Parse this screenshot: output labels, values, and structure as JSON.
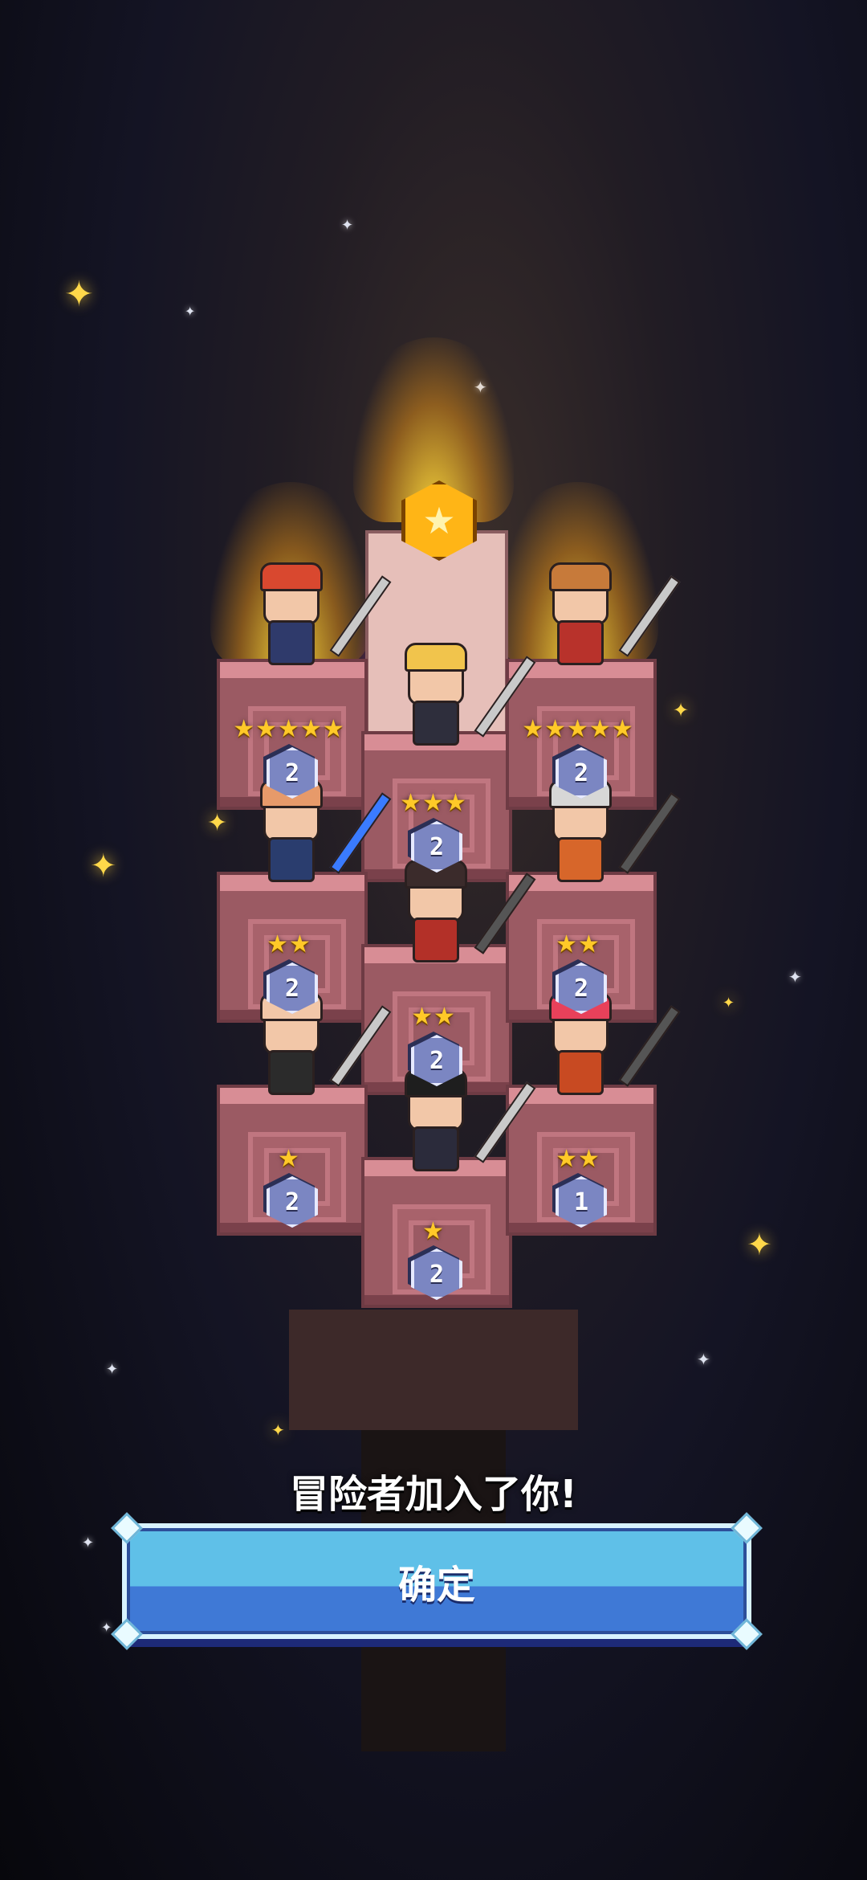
{
  "message": "冒险者加入了你!",
  "confirm_label": "确定",
  "top_medal": {
    "icon": "star-medal-icon",
    "star": "★"
  },
  "slots": [
    {
      "id": "top-left",
      "stars": "★★★★★",
      "level": "2",
      "highlight": "gold",
      "hair": "#d9482f",
      "outfit": "#2f3a6b"
    },
    {
      "id": "top-center",
      "stars": "★★★",
      "level": "2",
      "highlight": "pink",
      "hair": "#f1c44c",
      "outfit": "#2e2e3c"
    },
    {
      "id": "top-right",
      "stars": "★★★★★",
      "level": "2",
      "highlight": "gold",
      "hair": "#c77a3a",
      "outfit": "#b8322b"
    },
    {
      "id": "mid-left",
      "stars": "★★",
      "level": "2",
      "highlight": "",
      "hair": "#e79a6a",
      "outfit": "#2a3d6e"
    },
    {
      "id": "mid-center",
      "stars": "★★",
      "level": "2",
      "highlight": "",
      "hair": "#3b2b2b",
      "outfit": "#b33028"
    },
    {
      "id": "mid-right",
      "stars": "★★",
      "level": "2",
      "highlight": "",
      "hair": "#d7d7d7",
      "outfit": "#d7662a"
    },
    {
      "id": "low-left",
      "stars": "★",
      "level": "2",
      "highlight": "",
      "hair": "#f2c7a8",
      "outfit": "#2b2b2b"
    },
    {
      "id": "low-center",
      "stars": "★",
      "level": "2",
      "highlight": "",
      "hair": "#1e1e1e",
      "outfit": "#2b2b3b"
    },
    {
      "id": "low-right",
      "stars": "★★",
      "level": "1",
      "highlight": "",
      "hair": "#e8415a",
      "outfit": "#c84a22"
    }
  ],
  "colors": {
    "star": "#ffc928",
    "badge": "#7b86c2",
    "button_top": "#5fc0e8",
    "button_bottom": "#3f79d6"
  }
}
